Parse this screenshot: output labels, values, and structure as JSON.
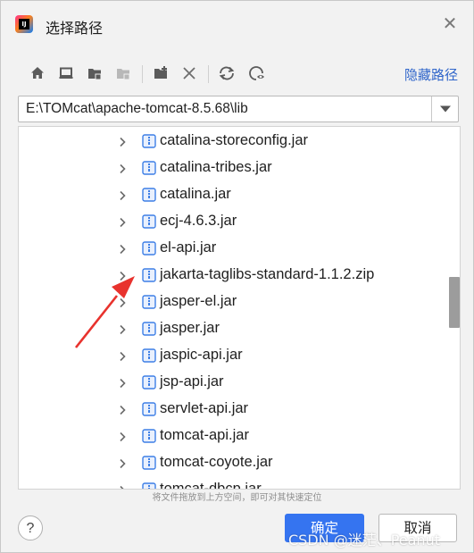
{
  "dialog": {
    "title": "选择路径",
    "app_icon_text": "IJ",
    "close_icon": "close-icon"
  },
  "toolbar": {
    "buttons": [
      "home-icon",
      "desktop-icon",
      "project-folder-icon",
      "module-folder-icon",
      "new-folder-icon",
      "delete-icon",
      "refresh-icon",
      "show-hidden-icon"
    ],
    "hide_path_link": "隐藏路径"
  },
  "path": {
    "value": "E:\\TOMcat\\apache-tomcat-8.5.68\\lib"
  },
  "tree": {
    "items": [
      {
        "name": "catalina-storeconfig.jar"
      },
      {
        "name": "catalina-tribes.jar"
      },
      {
        "name": "catalina.jar"
      },
      {
        "name": "ecj-4.6.3.jar"
      },
      {
        "name": "el-api.jar"
      },
      {
        "name": "jakarta-taglibs-standard-1.1.2.zip"
      },
      {
        "name": "jasper-el.jar"
      },
      {
        "name": "jasper.jar"
      },
      {
        "name": "jaspic-api.jar"
      },
      {
        "name": "jsp-api.jar"
      },
      {
        "name": "servlet-api.jar"
      },
      {
        "name": "tomcat-api.jar"
      },
      {
        "name": "tomcat-coyote.jar"
      },
      {
        "name": "tomcat-dbcp.jar"
      }
    ]
  },
  "hint": "将文件拖放到上方空间，即可对其快速定位",
  "buttons": {
    "help_label": "?",
    "ok_label": "确定",
    "cancel_label": "取消"
  },
  "watermark": "CSDN @迷茫、Peanut",
  "colors": {
    "accent": "#3574f0",
    "link": "#2f65ca",
    "annotation_arrow": "#e8322d",
    "file_icon": "#3d7fe6"
  }
}
